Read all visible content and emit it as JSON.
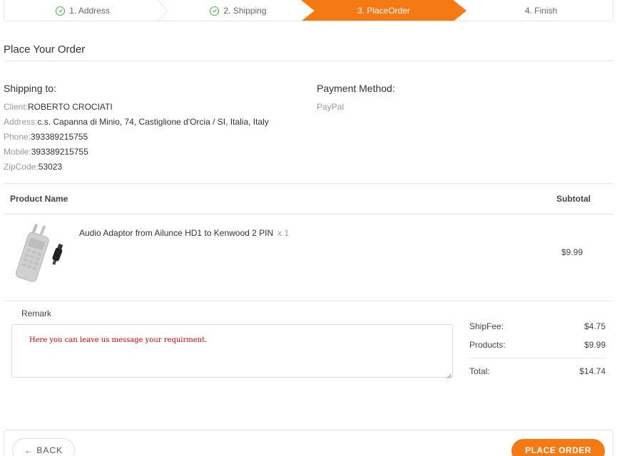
{
  "stepper": {
    "steps": [
      {
        "label": "1. Address",
        "state": "done"
      },
      {
        "label": "2. Shipping",
        "state": "done"
      },
      {
        "label": "3. PlaceOrder",
        "state": "active"
      },
      {
        "label": "4. Finish",
        "state": "pending"
      }
    ],
    "active_color": "#f57a14",
    "done_color": "#4caf50"
  },
  "page_title": "Place Your Order",
  "shipping": {
    "title": "Shipping to:",
    "client_label": "Client:",
    "client": "ROBERTO CROCIATI",
    "address_label": "Address:",
    "address": "c.s. Capanna di Minio, 74, Castiglione d'Orcia / SI, Italia, Italy",
    "phone_label": "Phone:",
    "phone": "393389215755",
    "mobile_label": "Mobile:",
    "mobile": "393389215755",
    "zip_label": "ZipCode:",
    "zip": "53023"
  },
  "payment": {
    "title": "Payment Method:",
    "method": "PayPal"
  },
  "table": {
    "col_product": "Product Name",
    "col_subtotal": "Subtotal",
    "rows": [
      {
        "name": "Audio Adaptor from Ailunce HD1 to Kenwood 2 PIN",
        "qty": "x 1",
        "subtotal": "$9.99",
        "image_icon": "radio-adaptor-image"
      }
    ]
  },
  "remark": {
    "label": "Remark",
    "placeholder": "Here you can leave us message your requirment."
  },
  "summary": {
    "shipfee_label": "ShipFee:",
    "shipfee": "$4.75",
    "products_label": "Products:",
    "products": "$9.99",
    "total_label": "Total:",
    "total": "$14.74"
  },
  "footer": {
    "back_label": "← BACK",
    "place_label": "PLACE ORDER"
  }
}
